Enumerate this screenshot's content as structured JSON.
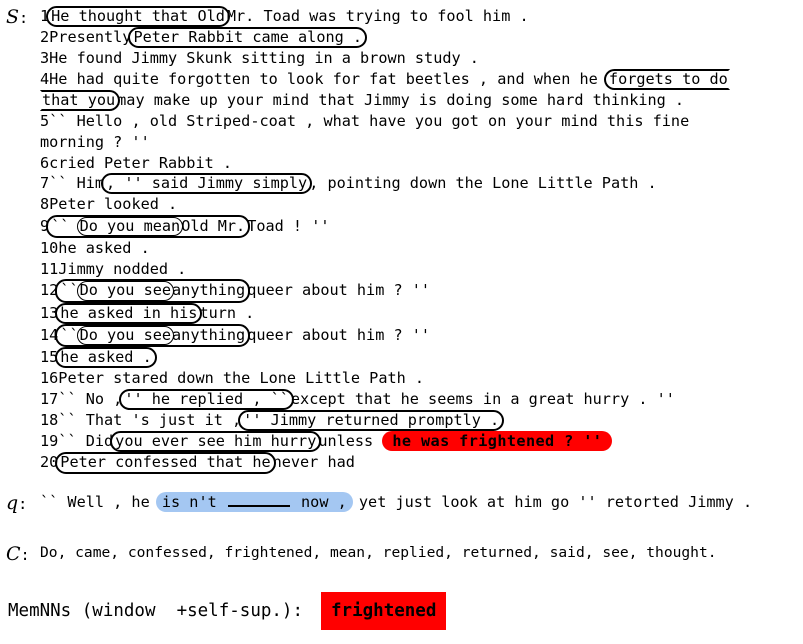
{
  "markers": {
    "story": "S",
    "query": "q",
    "candidates": "C",
    "colon": ":"
  },
  "colors": {
    "answer_red": "#ff0000",
    "query_blue": "#a4c7f2",
    "box_border": "#000000",
    "background": "#ffffff"
  },
  "story": {
    "lines": [
      {
        "num": "1",
        "parts": [
          {
            "t": "box",
            "text": "He thought that Old"
          },
          {
            "t": "plain",
            "text": "Mr. Toad was trying to fool him ."
          }
        ]
      },
      {
        "num": "2",
        "parts": [
          {
            "t": "plain",
            "text": "Presently"
          },
          {
            "t": "box",
            "text": "Peter Rabbit came along ."
          }
        ]
      },
      {
        "num": "3",
        "parts": [
          {
            "t": "plain",
            "text": "He found Jimmy Skunk sitting in a brown study ."
          }
        ]
      },
      {
        "num": "4",
        "parts": [
          {
            "t": "plain",
            "text": "He had quite forgotten to look for fat beetles , and when he "
          },
          {
            "t": "box-open-right",
            "text": "forgets to do"
          }
        ]
      },
      {
        "num": "",
        "parts": [
          {
            "t": "box-open-left",
            "text": "that you"
          },
          {
            "t": "plain",
            "text": "may make up your mind that Jimmy is doing some hard thinking ."
          }
        ]
      },
      {
        "num": "5",
        "parts": [
          {
            "t": "plain",
            "text": "`` Hello , old Striped-coat , what have you got on your mind this fine"
          }
        ]
      },
      {
        "num": "",
        "parts": [
          {
            "t": "plain",
            "text": "morning ? ''"
          }
        ]
      },
      {
        "num": "6",
        "parts": [
          {
            "t": "plain",
            "text": "cried Peter Rabbit ."
          }
        ]
      },
      {
        "num": "7",
        "parts": [
          {
            "t": "plain",
            "text": "`` Him"
          },
          {
            "t": "box",
            "text": ", '' said Jimmy simply"
          },
          {
            "t": "plain",
            "text": ", pointing down the Lone Little Path ."
          }
        ]
      },
      {
        "num": "8",
        "parts": [
          {
            "t": "plain",
            "text": "Peter looked ."
          }
        ]
      },
      {
        "num": "9",
        "parts": [
          {
            "t": "nest",
            "pre": "`` ",
            "inner": "Do you mean",
            "post": "Old Mr."
          },
          {
            "t": "plain",
            "text": "Toad ! ''"
          }
        ]
      },
      {
        "num": "10",
        "parts": [
          {
            "t": "plain",
            "text": "he asked ."
          }
        ]
      },
      {
        "num": "11",
        "parts": [
          {
            "t": "plain",
            "text": "Jimmy nodded ."
          }
        ]
      },
      {
        "num": "12",
        "parts": [
          {
            "t": "nest",
            "pre": "``",
            "inner": "Do you see",
            "post": "anything"
          },
          {
            "t": "plain",
            "text": "queer about him ? ''"
          }
        ]
      },
      {
        "num": "13",
        "parts": [
          {
            "t": "box",
            "text": "he asked in his"
          },
          {
            "t": "plain",
            "text": "turn ."
          }
        ]
      },
      {
        "num": "14",
        "parts": [
          {
            "t": "nest",
            "pre": "``",
            "inner": "Do you see",
            "post": "anything"
          },
          {
            "t": "plain",
            "text": "queer about him ? ''"
          }
        ]
      },
      {
        "num": "15",
        "parts": [
          {
            "t": "box",
            "text": "he asked ."
          }
        ]
      },
      {
        "num": "16",
        "parts": [
          {
            "t": "plain",
            "text": "Peter stared down the Lone Little Path ."
          }
        ]
      },
      {
        "num": "17",
        "parts": [
          {
            "t": "plain",
            "text": "`` No ,"
          },
          {
            "t": "box",
            "text": "'' he replied , ``"
          },
          {
            "t": "plain",
            "text": "except that he seems in a great hurry . ''"
          }
        ]
      },
      {
        "num": "18",
        "parts": [
          {
            "t": "plain",
            "text": "`` That 's just it ,"
          },
          {
            "t": "box",
            "text": "'' Jimmy returned promptly ."
          }
        ]
      },
      {
        "num": "19",
        "parts": [
          {
            "t": "plain",
            "text": "`` Did"
          },
          {
            "t": "box",
            "text": "you ever see him hurry"
          },
          {
            "t": "plain",
            "text": "unless "
          },
          {
            "t": "red",
            "text": "he was frightened ? ''"
          }
        ]
      },
      {
        "num": "20",
        "parts": [
          {
            "t": "box",
            "text": "Peter confessed that he"
          },
          {
            "t": "plain",
            "text": "never had"
          }
        ]
      }
    ]
  },
  "query": {
    "prefix": "`` Well , he ",
    "highlight_before": "is n't ",
    "blank": "______",
    "highlight_after": " now ,",
    "suffix": " yet just look at him go '' retorted Jimmy ."
  },
  "candidates": {
    "text": "Do, came, confessed, frightened, mean, replied, returned, said, see, thought."
  },
  "prediction": {
    "label": "MemNNs (window  +self-sup.):",
    "answer": "frightened"
  }
}
